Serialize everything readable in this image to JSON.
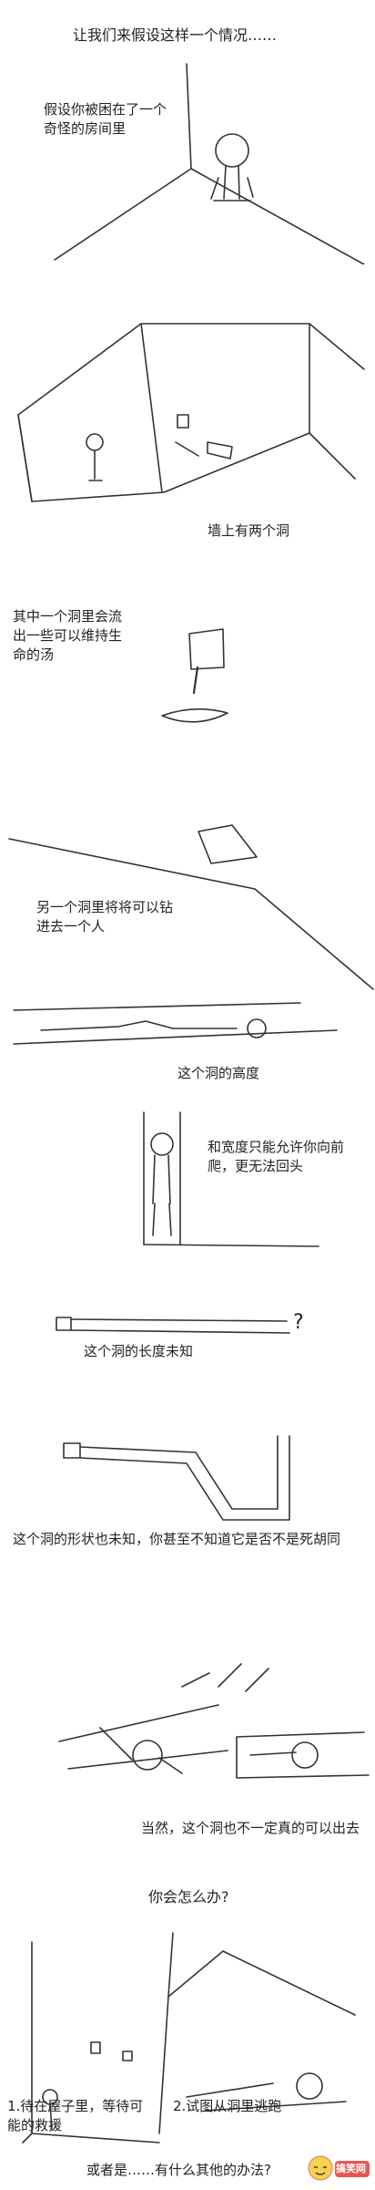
{
  "intro": "让我们来假设这样一个情况……",
  "panel1": "假设你被困在了一个奇怪的房间里",
  "panel2": "墙上有两个洞",
  "panel3": "其中一个洞里会流出一些可以维持生命的汤",
  "panel4": "另一个洞里将将可以钻进去一个人",
  "panel5": "这个洞的高度",
  "panel6": "和宽度只能允许你向前爬，更无法回头",
  "panel7": "这个洞的长度未知",
  "panel7_mark": "?",
  "panel8": "这个洞的形状也未知，你甚至不知道它是否不是死胡同",
  "panel9": "当然，这个洞也不一定真的可以出去",
  "question": "你会怎么办?",
  "option1": "1.待在屋子里，等待可能的救援",
  "option2": "2.试图从洞里逃跑",
  "closing": "或者是……有什么其他的办法?",
  "watermark": "搞笑网"
}
